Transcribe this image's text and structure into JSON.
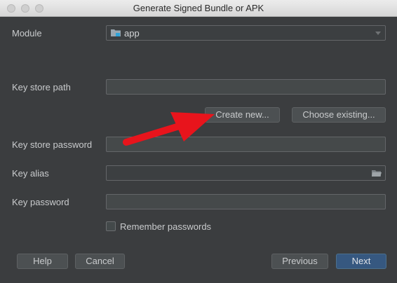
{
  "window": {
    "title": "Generate Signed Bundle or APK"
  },
  "module": {
    "label": "Module",
    "value": "app"
  },
  "keystore_path": {
    "label": "Key store path",
    "value": ""
  },
  "buttons": {
    "create_new": "Create new...",
    "choose_existing": "Choose existing...",
    "help": "Help",
    "cancel": "Cancel",
    "previous": "Previous",
    "next": "Next"
  },
  "keystore_password": {
    "label": "Key store password",
    "value": ""
  },
  "key_alias": {
    "label": "Key alias",
    "value": ""
  },
  "key_password": {
    "label": "Key password",
    "value": ""
  },
  "remember": {
    "label": "Remember passwords",
    "checked": false
  },
  "colors": {
    "accent": "#365880",
    "annotation_arrow": "#e8141c"
  }
}
